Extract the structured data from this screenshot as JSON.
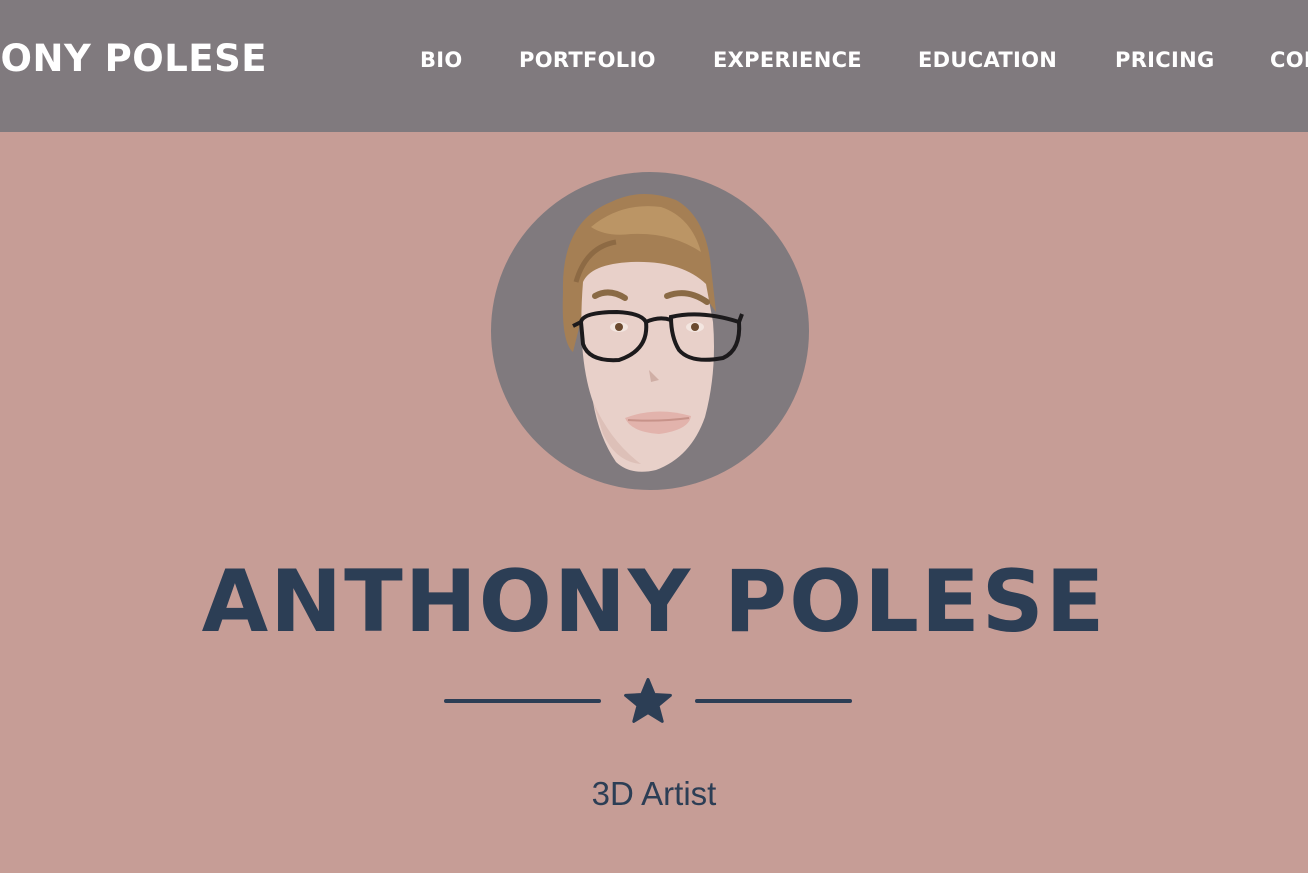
{
  "navbar": {
    "brand": "ANTHONY POLESE",
    "links": [
      {
        "label": "BIO"
      },
      {
        "label": "PORTFOLIO"
      },
      {
        "label": "EXPERIENCE"
      },
      {
        "label": "EDUCATION"
      },
      {
        "label": "PRICING"
      },
      {
        "label": "CONTACT"
      }
    ]
  },
  "hero": {
    "avatar_icon": "avatar-portrait",
    "title": "ANTHONY POLESE",
    "divider_icon": "star-icon",
    "subtitle": "3D Artist"
  },
  "colors": {
    "page_background": "#c69d96",
    "navbar_background": "#807a7e",
    "navbar_text": "#ffffff",
    "heading_text": "#2c3e55"
  }
}
